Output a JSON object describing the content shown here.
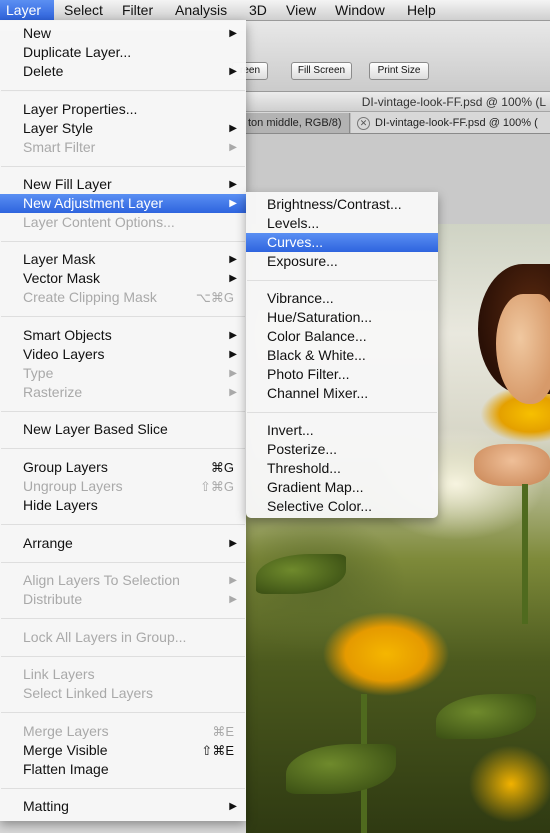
{
  "menubar": {
    "items": [
      "Layer",
      "Select",
      "Filter",
      "Analysis",
      "3D",
      "View",
      "Window",
      "Help"
    ],
    "active": "Layer"
  },
  "options_bar": {
    "buttons": [
      "reen",
      "Fill Screen",
      "Print Size"
    ]
  },
  "document": {
    "title": "DI-vintage-look-FF.psd @ 100% (L",
    "tab_left": "ton middle, RGB/8)",
    "tab_right": "DI-vintage-look-FF.psd @ 100% ("
  },
  "layer_menu": {
    "items": [
      {
        "label": "New",
        "arrow": "▶"
      },
      {
        "label": "Duplicate Layer..."
      },
      {
        "label": "Delete",
        "arrow": "▶"
      },
      {
        "label": "Layer Properties..."
      },
      {
        "label": "Layer Style",
        "arrow": "▶"
      },
      {
        "label": "Smart Filter",
        "arrow": "▶"
      },
      {
        "label": "New Fill Layer",
        "arrow": "▶"
      },
      {
        "label": "New Adjustment Layer",
        "arrow": "▶"
      },
      {
        "label": "Layer Content Options..."
      },
      {
        "label": "Layer Mask",
        "arrow": "▶"
      },
      {
        "label": "Vector Mask",
        "arrow": "▶"
      },
      {
        "label": "Create Clipping Mask",
        "shortcut": "⌥⌘G"
      },
      {
        "label": "Smart Objects",
        "arrow": "▶"
      },
      {
        "label": "Video Layers",
        "arrow": "▶"
      },
      {
        "label": "Type",
        "arrow": "▶"
      },
      {
        "label": "Rasterize",
        "arrow": "▶"
      },
      {
        "label": "New Layer Based Slice"
      },
      {
        "label": "Group Layers",
        "shortcut": "⌘G"
      },
      {
        "label": "Ungroup Layers",
        "shortcut": "⇧⌘G"
      },
      {
        "label": "Hide Layers"
      },
      {
        "label": "Arrange",
        "arrow": "▶"
      },
      {
        "label": "Align Layers To Selection",
        "arrow": "▶"
      },
      {
        "label": "Distribute",
        "arrow": "▶"
      },
      {
        "label": "Lock All Layers in Group..."
      },
      {
        "label": "Link Layers"
      },
      {
        "label": "Select Linked Layers"
      },
      {
        "label": "Merge Layers",
        "shortcut": "⌘E"
      },
      {
        "label": "Merge Visible",
        "shortcut": "⇧⌘E"
      },
      {
        "label": "Flatten Image"
      },
      {
        "label": "Matting",
        "arrow": "▶"
      }
    ]
  },
  "adjustment_submenu": {
    "items": [
      {
        "label": "Brightness/Contrast..."
      },
      {
        "label": "Levels..."
      },
      {
        "label": "Curves..."
      },
      {
        "label": "Exposure..."
      },
      {
        "label": "Vibrance..."
      },
      {
        "label": "Hue/Saturation..."
      },
      {
        "label": "Color Balance..."
      },
      {
        "label": "Black & White..."
      },
      {
        "label": "Photo Filter..."
      },
      {
        "label": "Channel Mixer..."
      },
      {
        "label": "Invert..."
      },
      {
        "label": "Posterize..."
      },
      {
        "label": "Threshold..."
      },
      {
        "label": "Gradient Map..."
      },
      {
        "label": "Selective Color..."
      }
    ]
  },
  "colors": {
    "highlight": "#3a6fe4",
    "disabled_text": "#a9a9a9"
  }
}
